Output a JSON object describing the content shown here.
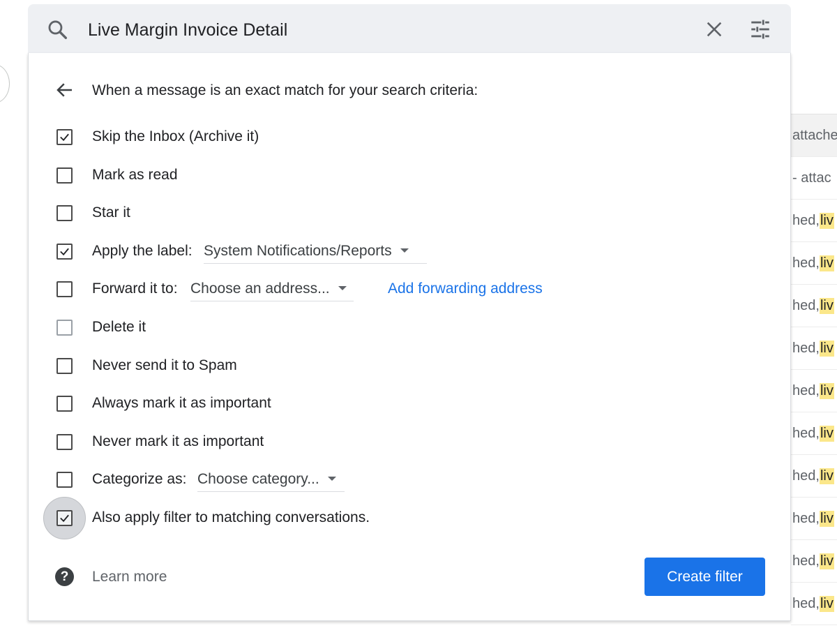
{
  "search": {
    "query": "Live Margin Invoice Detail",
    "search_icon": "search-icon",
    "clear_icon": "close-icon",
    "options_icon": "tune-icon"
  },
  "filter": {
    "header": "When a message is an exact match for your search criteria:",
    "options": [
      {
        "label": "Skip the Inbox (Archive it)",
        "checked": true
      },
      {
        "label": "Mark as read",
        "checked": false
      },
      {
        "label": "Star it",
        "checked": false
      },
      {
        "label": "Apply the label:",
        "checked": true,
        "select": "System Notifications/Reports"
      },
      {
        "label": "Forward it to:",
        "checked": false,
        "select": "Choose an address...",
        "link": "Add forwarding address"
      },
      {
        "label": "Delete it",
        "checked": false
      },
      {
        "label": "Never send it to Spam",
        "checked": false
      },
      {
        "label": "Always mark it as important",
        "checked": false
      },
      {
        "label": "Never mark it as important",
        "checked": false
      },
      {
        "label": "Categorize as:",
        "checked": false,
        "select": "Choose category..."
      },
      {
        "label": "Also apply filter to matching conversations.",
        "checked": true
      }
    ],
    "learn_more": "Learn more",
    "create_button": "Create filter"
  },
  "background_list": {
    "rows": [
      {
        "text": "attache"
      },
      {
        "text": "- attac"
      },
      {
        "text": "hed, ",
        "highlight": "liv"
      },
      {
        "text": "hed, ",
        "highlight": "liv"
      },
      {
        "text": "hed, ",
        "highlight": "liv"
      },
      {
        "text": "hed, ",
        "highlight": "liv"
      },
      {
        "text": "hed, ",
        "highlight": "liv"
      },
      {
        "text": "hed, ",
        "highlight": "liv"
      },
      {
        "text": "hed, ",
        "highlight": "liv"
      },
      {
        "text": "hed, ",
        "highlight": "liv"
      },
      {
        "text": "hed, ",
        "highlight": "liv"
      },
      {
        "text": "hed, ",
        "highlight": "liv"
      }
    ]
  },
  "colors": {
    "accent": "#1a73e8",
    "highlight": "#fbe78a",
    "search_bg": "#eef0f3"
  }
}
